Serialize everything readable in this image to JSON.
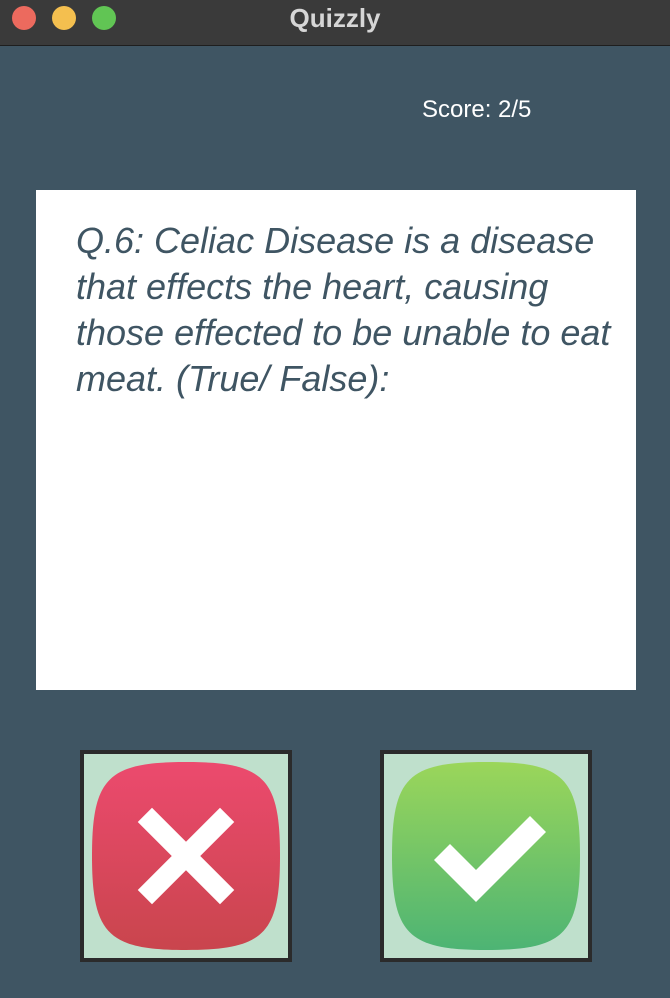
{
  "window": {
    "title": "Quizzly"
  },
  "score": {
    "label": "Score: 2/5"
  },
  "question": {
    "text": "Q.6: Celiac Disease is a disease that effects the heart, causing those effected to be unable to eat meat. (True/ False):"
  },
  "answers": [
    {
      "name": "false",
      "icon": "close-icon",
      "color": "#d9485f"
    },
    {
      "name": "true",
      "icon": "check-icon",
      "color": "#5cbf6b"
    }
  ],
  "colors": {
    "background": "#3f5563",
    "card": "#ffffff",
    "question_text": "#3f5563",
    "button_frame": "#bfe0cc"
  }
}
